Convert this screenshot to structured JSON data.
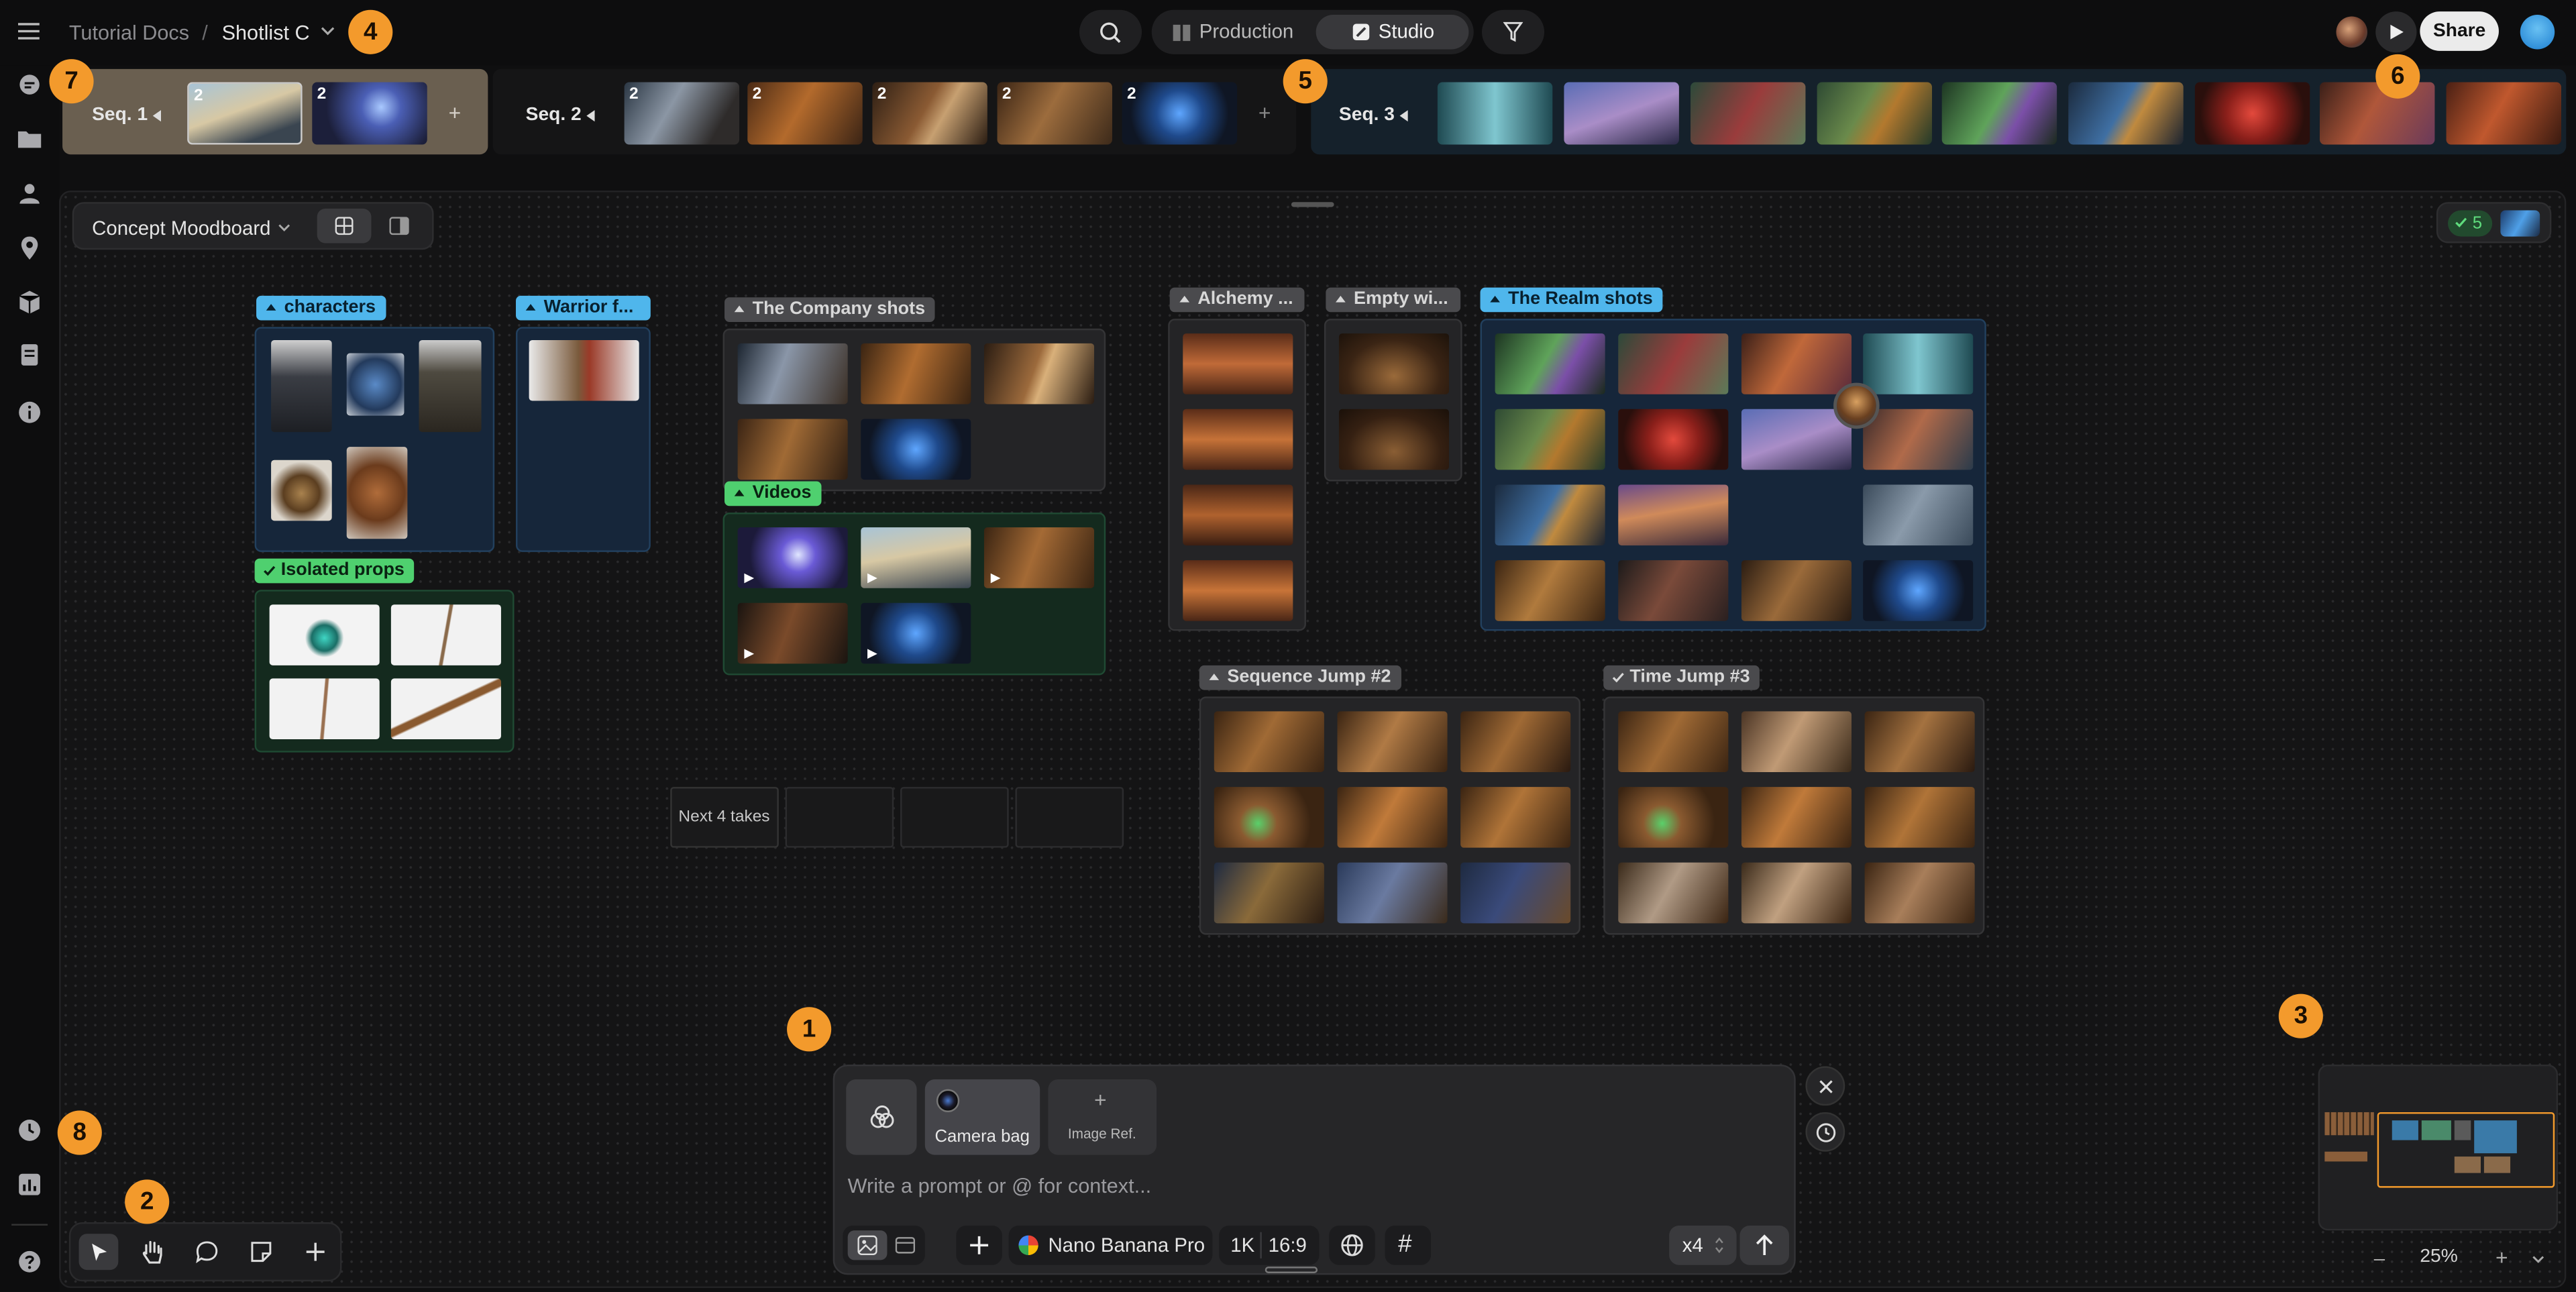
{
  "breadcrumb": {
    "project": "Tutorial Docs",
    "separator": "/",
    "shotlist": "Shotlist C"
  },
  "modes": {
    "production": "Production",
    "studio": "Studio"
  },
  "share_label": "Share",
  "markers": [
    "1",
    "2",
    "3",
    "4",
    "5",
    "6",
    "7",
    "8"
  ],
  "sequences": [
    {
      "label": "Seq. 1",
      "add": "+",
      "thumbs": [
        {
          "count": "2"
        },
        {
          "count": "2"
        }
      ]
    },
    {
      "label": "Seq. 2",
      "add": "+",
      "thumbs": [
        {
          "count": "2"
        },
        {
          "count": "2"
        },
        {
          "count": "2"
        },
        {
          "count": "2"
        },
        {
          "count": "2"
        }
      ]
    },
    {
      "label": "Seq. 3",
      "thumbs": [
        {},
        {},
        {},
        {},
        {},
        {},
        {},
        {},
        {},
        {}
      ]
    }
  ],
  "board": {
    "name": "Concept Moodboard",
    "approved_count": "5"
  },
  "groups": {
    "characters": "characters",
    "warrior": "Warrior f...",
    "isolated_props": "Isolated props",
    "company": "The Company shots",
    "videos": "Videos",
    "alchemy": "Alchemy ...",
    "empty": "Empty wi...",
    "realm": "The Realm shots",
    "sequence_jump": "Sequence Jump #2",
    "time_jump": "Time Jump #3"
  },
  "next_takes": "Next 4 takes",
  "prompt": {
    "camera_bag": "Camera bag",
    "image_ref": "Image Ref.",
    "image_ref_plus": "+",
    "placeholder": "Write a prompt or @ for context...",
    "model": "Nano Banana Pro",
    "resolution": "1K",
    "aspect": "16:9",
    "count": "x4",
    "hash": "#"
  },
  "zoom": {
    "minus": "–",
    "value": "25%",
    "plus": "+"
  },
  "colors": {
    "accent_orange": "#f39a2c",
    "tag_blue": "#4fb6ec",
    "tag_green": "#4fd06f",
    "tag_gray": "#a3a3a6"
  }
}
